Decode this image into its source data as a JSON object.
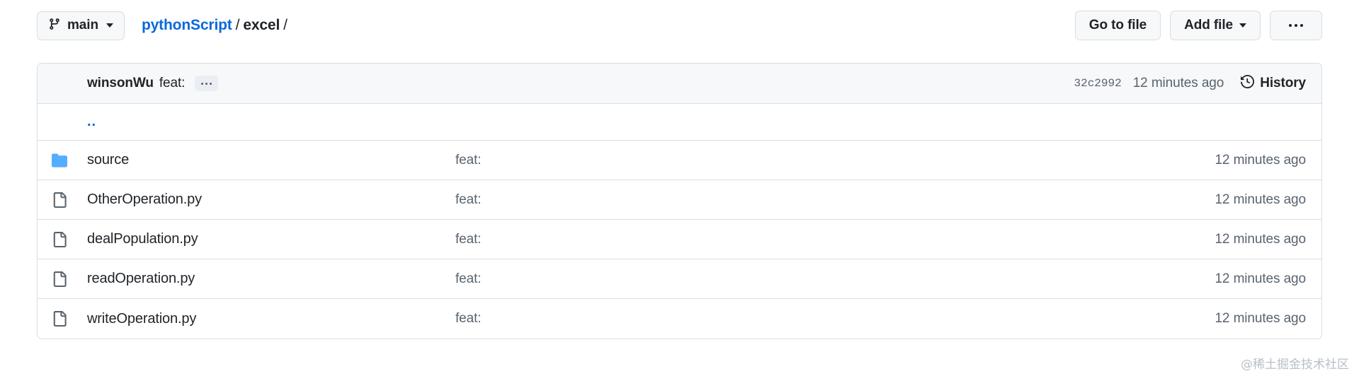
{
  "toolbar": {
    "branch": {
      "name": "main",
      "icon": "git-branch-icon"
    },
    "breadcrumb": {
      "repo": "pythonScript",
      "sep1": "/",
      "dir": "excel",
      "sep2": "/"
    },
    "go_to_file": "Go to file",
    "add_file": "Add file",
    "more_options": "…"
  },
  "commit_header": {
    "author": "winsonWu",
    "message": "feat:",
    "expand_label": "…",
    "sha": "32c2992",
    "time": "12 minutes ago",
    "history_label": "History",
    "history_icon": "clock-history-icon"
  },
  "file_table": {
    "parent_link": "..",
    "rows": [
      {
        "name": "source",
        "type": "folder",
        "icon": "folder-icon",
        "message": "feat:",
        "time": "12 minutes ago"
      },
      {
        "name": "OtherOperation.py",
        "type": "file",
        "icon": "file-icon",
        "message": "feat:",
        "time": "12 minutes ago"
      },
      {
        "name": "dealPopulation.py",
        "type": "file",
        "icon": "file-icon",
        "message": "feat:",
        "time": "12 minutes ago"
      },
      {
        "name": "readOperation.py",
        "type": "file",
        "icon": "file-icon",
        "message": "feat:",
        "time": "12 minutes ago"
      },
      {
        "name": "writeOperation.py",
        "type": "file",
        "icon": "file-icon",
        "message": "feat:",
        "time": "12 minutes ago"
      }
    ]
  },
  "watermark": "@稀土掘金技术社区",
  "colors": {
    "link": "#0969da",
    "folder": "#54aeff",
    "muted": "#59636e",
    "border": "#d8dee4",
    "header_bg": "#f6f8fa"
  }
}
